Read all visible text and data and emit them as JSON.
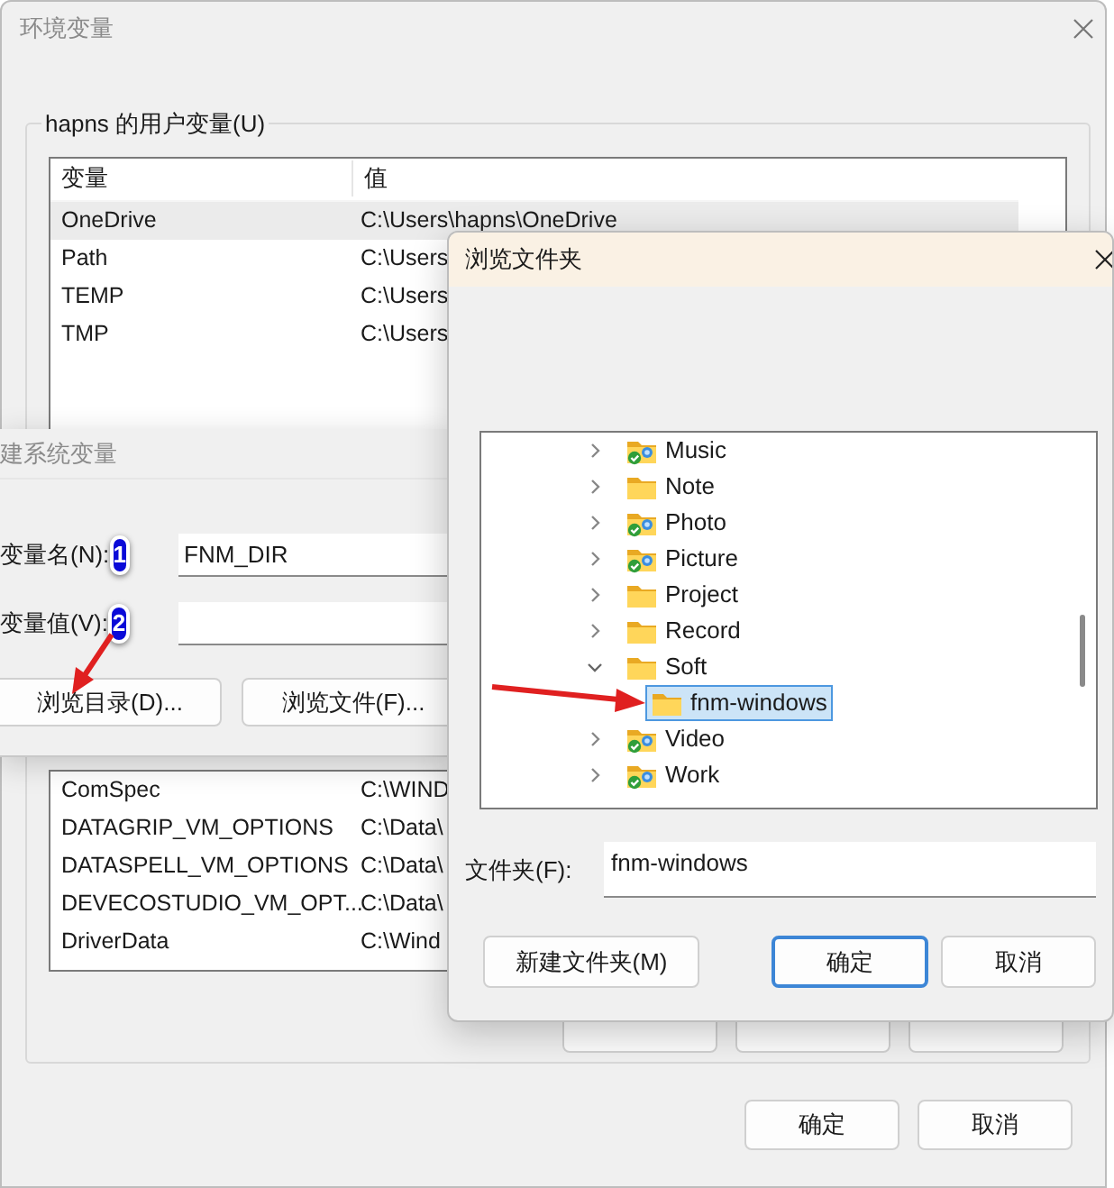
{
  "main_window": {
    "title": "环境变量",
    "user_variables": {
      "title": "hapns 的用户变量(U)",
      "columns": [
        "变量",
        "值"
      ],
      "rows": [
        {
          "name": "OneDrive",
          "value": "C:\\Users\\hapns\\OneDrive",
          "selected": true
        },
        {
          "name": "Path",
          "value": "C:\\Users",
          "selected": false
        },
        {
          "name": "TEMP",
          "value": "C:\\Users",
          "selected": false
        },
        {
          "name": "TMP",
          "value": "C:\\Users",
          "selected": false
        }
      ]
    },
    "system_variables": {
      "rows": [
        {
          "name": "ComSpec",
          "value": "C:\\WIND",
          "selected": false
        },
        {
          "name": "DATAGRIP_VM_OPTIONS",
          "value": "C:\\Data\\",
          "selected": false
        },
        {
          "name": "DATASPELL_VM_OPTIONS",
          "value": "C:\\Data\\",
          "selected": false
        },
        {
          "name": "DEVECOSTUDIO_VM_OPT...",
          "value": "C:\\Data\\",
          "selected": false
        },
        {
          "name": "DriverData",
          "value": "C:\\Wind",
          "selected": false
        }
      ]
    },
    "buttons": [
      "确定",
      "取消"
    ]
  },
  "new_variable_dialog": {
    "title": "建系统变量",
    "fields": [
      {
        "label": "变量名(N):",
        "badge": "1",
        "value": "FNM_DIR"
      },
      {
        "label": "变量值(V):",
        "badge": "2"
      }
    ],
    "buttons": [
      "浏览目录(D)...",
      "浏览文件(F)..."
    ]
  },
  "browse_dialog": {
    "title": "浏览文件夹",
    "tree": [
      {
        "label": "Music",
        "synced": true,
        "expanded": false,
        "selected": false
      },
      {
        "label": "Note",
        "synced": false,
        "expanded": false,
        "selected": false
      },
      {
        "label": "Photo",
        "synced": true,
        "expanded": false,
        "selected": false
      },
      {
        "label": "Picture",
        "synced": true,
        "expanded": false,
        "selected": false
      },
      {
        "label": "Project",
        "synced": false,
        "expanded": false,
        "selected": false
      },
      {
        "label": "Record",
        "synced": false,
        "expanded": false,
        "selected": false
      },
      {
        "label": "Soft",
        "synced": false,
        "expanded": true,
        "selected": false,
        "children": [
          {
            "label": "fnm-windows",
            "synced": false,
            "selected": true
          }
        ]
      },
      {
        "label": "Video",
        "synced": true,
        "expanded": false,
        "selected": false
      },
      {
        "label": "Work",
        "synced": true,
        "expanded": false,
        "selected": false
      }
    ],
    "folder_label": "文件夹(F):",
    "folder_value": "fnm-windows",
    "buttons": [
      {
        "label": "新建文件夹(M)",
        "default": false
      },
      {
        "label": "确定",
        "default": true
      },
      {
        "label": "取消",
        "default": false
      }
    ]
  }
}
